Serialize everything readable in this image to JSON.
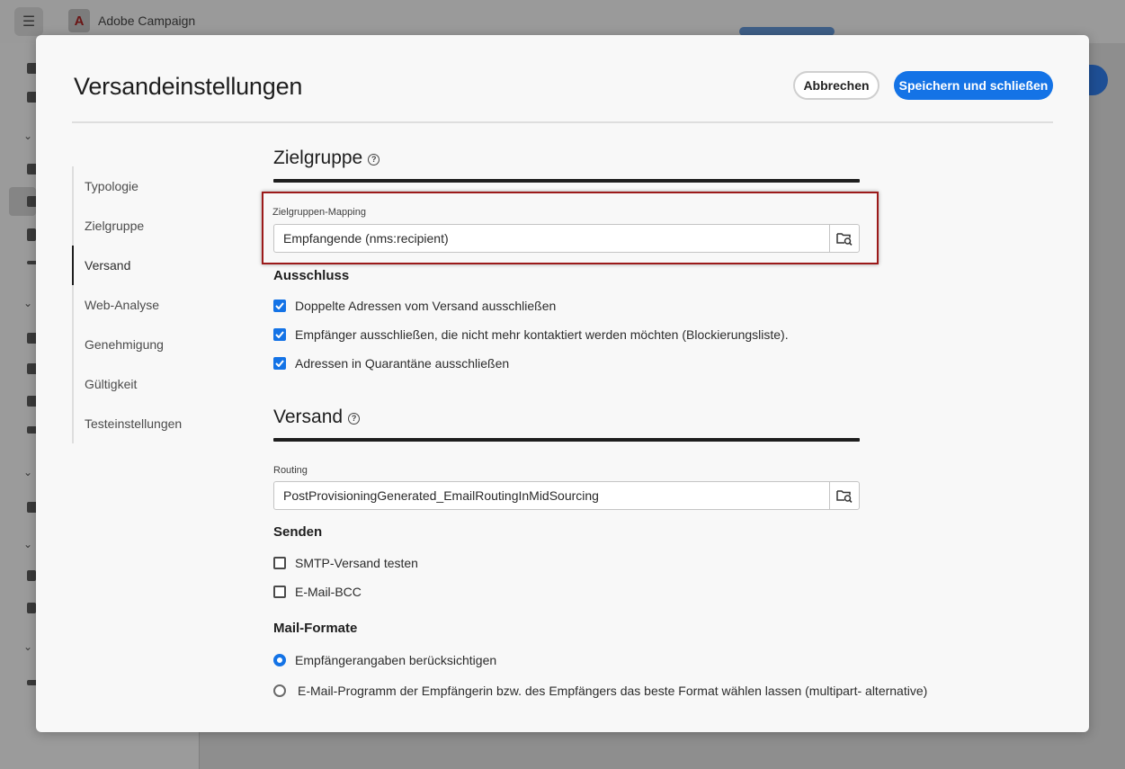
{
  "app": {
    "title": "Adobe Campaign",
    "logo_letter": "A",
    "menu_icon": "hamburger-icon",
    "accent": "#1473e6"
  },
  "dialog": {
    "title": "Versandeinstellungen",
    "cancel_label": "Abbrechen",
    "save_label": "Speichern und schließen"
  },
  "nav": {
    "items": [
      {
        "label": "Typologie"
      },
      {
        "label": "Zielgruppe"
      },
      {
        "label": "Versand",
        "active": true
      },
      {
        "label": "Web-Analyse"
      },
      {
        "label": "Genehmigung"
      },
      {
        "label": "Gültigkeit"
      },
      {
        "label": "Testeinstellungen"
      }
    ]
  },
  "audience": {
    "heading": "Zielgruppe",
    "mapping_label": "Zielgruppen-Mapping",
    "mapping_value": "Empfangende (nms:recipient)",
    "exclusion_heading": "Ausschluss",
    "exclusions": [
      {
        "label": "Doppelte Adressen vom Versand ausschließen",
        "checked": true
      },
      {
        "label": "Empfänger ausschließen, die nicht mehr kontaktiert werden möchten (Blockierungsliste).",
        "checked": true
      },
      {
        "label": "Adressen in Quarantäne ausschließen",
        "checked": true
      }
    ]
  },
  "delivery": {
    "heading": "Versand",
    "routing_label": "Routing",
    "routing_value": "PostProvisioningGenerated_EmailRoutingInMidSourcing",
    "send_heading": "Senden",
    "send_options": [
      {
        "label": "SMTP-Versand testen",
        "checked": false
      },
      {
        "label": "E-Mail-BCC",
        "checked": false
      }
    ],
    "formats_heading": "Mail-Formate",
    "formats": [
      {
        "label": "Empfängerangaben berücksichtigen",
        "selected": true
      },
      {
        "label": "E-Mail-Programm der Empfängerin bzw. des Empfängers das beste Format wählen lassen  (multipart- alternative)",
        "selected": false
      }
    ]
  },
  "highlight_color": "#9c1a1a"
}
